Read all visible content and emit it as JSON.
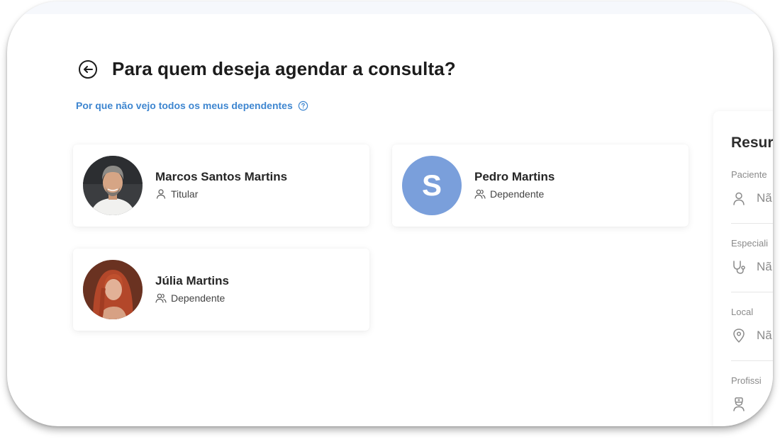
{
  "header": {
    "title": "Para quem deseja agendar a consulta?",
    "help_link": "Por que não vejo todos os meus dependentes"
  },
  "patients": [
    {
      "name": "Marcos Santos Martins",
      "role": "Titular",
      "avatar": "photo"
    },
    {
      "name": "Pedro Martins",
      "role": "Dependente",
      "avatar": "letter",
      "initial": "S",
      "avatar_color": "#7a9fdb"
    },
    {
      "name": "Júlia Martins",
      "role": "Dependente",
      "avatar": "photo"
    }
  ],
  "summary": {
    "title": "Resur",
    "patient": {
      "label": "Paciente",
      "value": "Nã"
    },
    "specialty": {
      "label": "Especiali",
      "value": "Nã"
    },
    "location": {
      "label": "Local",
      "value": "Nã"
    },
    "professional": {
      "label": "Profissi"
    }
  },
  "colors": {
    "link": "#3e86d0",
    "avatar_letter_bg": "#7a9fdb",
    "title": "#1c1c1c"
  }
}
